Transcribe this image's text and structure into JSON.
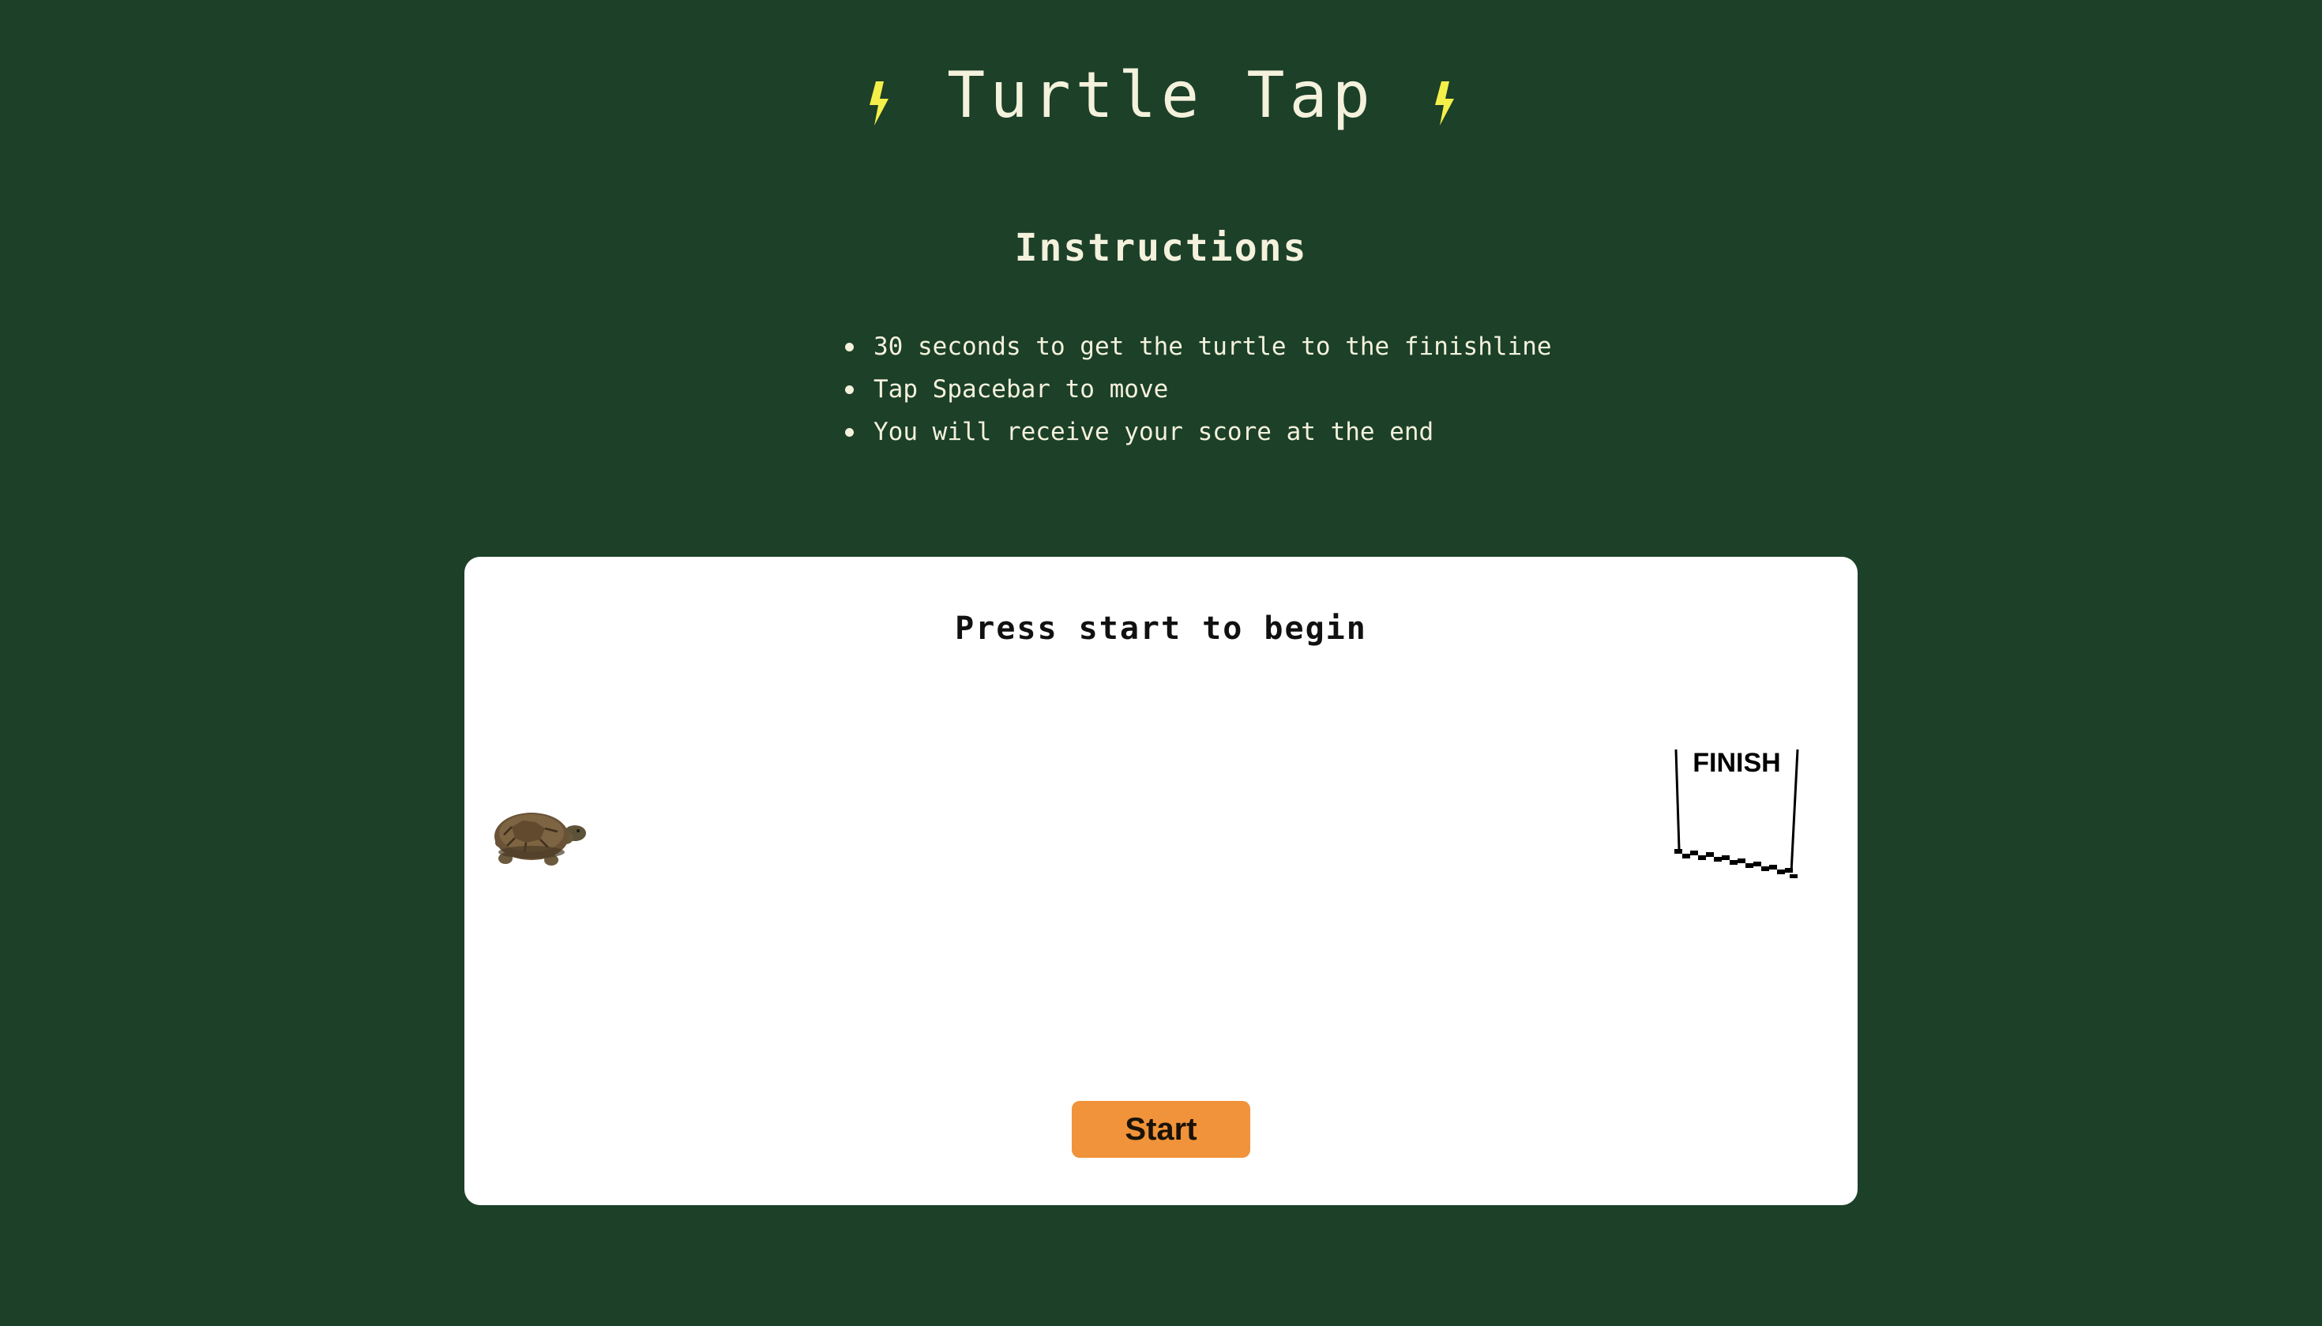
{
  "header": {
    "title": "Turtle Tap",
    "left_icon": "lightning-bolt-icon",
    "right_icon": "lightning-bolt-icon",
    "bolt_color": "#f5ef4a"
  },
  "instructions": {
    "heading": "Instructions",
    "items": [
      "30 seconds to get the turtle to the finishline",
      "Tap Spacebar to move",
      "You will receive your score at the end"
    ]
  },
  "game": {
    "status": "Press start to begin",
    "turtle_icon": "turtle-icon",
    "finish_icon": "finish-line-icon",
    "finish_label": "FINISH",
    "start_label": "Start"
  },
  "colors": {
    "background": "#1c4028",
    "text": "#f4f1dc",
    "panel": "#ffffff",
    "button": "#f0933a"
  }
}
